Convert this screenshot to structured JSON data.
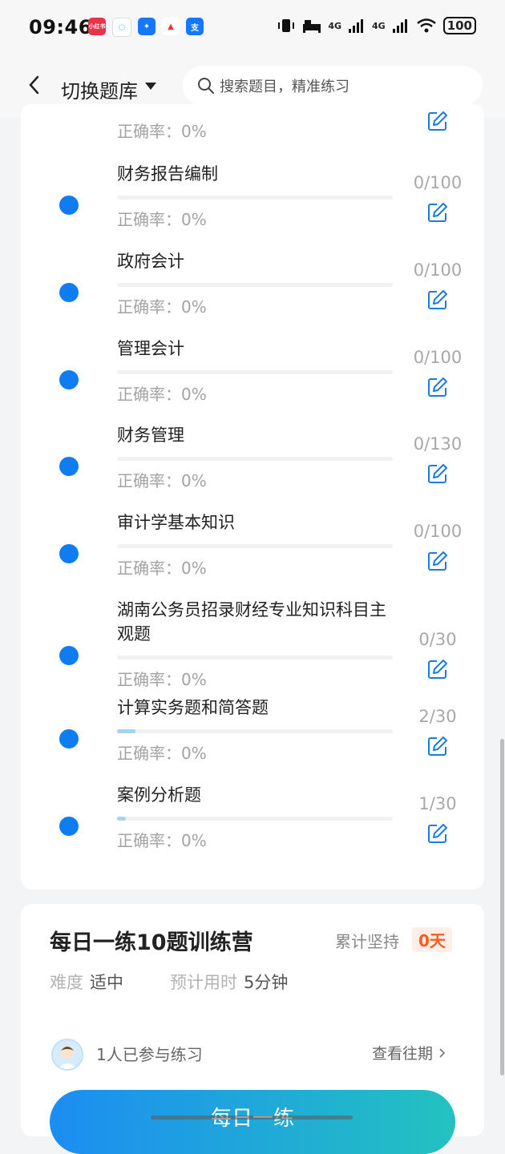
{
  "status": {
    "time": "09:46",
    "battery": "100",
    "net1": "4G",
    "net2": "4G",
    "apps": [
      "小红书",
      "◌",
      "✦",
      "▲",
      "支"
    ]
  },
  "header": {
    "switch_label": "切换题库",
    "search_placeholder": "搜索题目，精准练习"
  },
  "first_row_accuracy": "正确率：0%",
  "subjects": [
    {
      "title": "财务报告编制",
      "accuracy": "正确率：0%",
      "count": "0/100",
      "progress": 0
    },
    {
      "title": "政府会计",
      "accuracy": "正确率：0%",
      "count": "0/100",
      "progress": 0
    },
    {
      "title": "管理会计",
      "accuracy": "正确率：0%",
      "count": "0/100",
      "progress": 0
    },
    {
      "title": "财务管理",
      "accuracy": "正确率：0%",
      "count": "0/130",
      "progress": 0
    },
    {
      "title": "审计学基本知识",
      "accuracy": "正确率：0%",
      "count": "0/100",
      "progress": 0
    },
    {
      "title": "湖南公务员招录财经专业知识科目主观题",
      "accuracy": "正确率：0%",
      "count": "0/30",
      "progress": 0
    },
    {
      "title": "计算实务题和简答题",
      "accuracy": "正确率：0%",
      "count": "2/30",
      "progress": 0.067
    },
    {
      "title": "案例分析题",
      "accuracy": "正确率：0%",
      "count": "1/30",
      "progress": 0.033
    }
  ],
  "camp": {
    "title": "每日一练10题训练营",
    "streak_label": "累计坚持",
    "streak_value": "0天",
    "difficulty_label": "难度",
    "difficulty_value": "适中",
    "time_label": "预计用时",
    "time_value": "5分钟",
    "participants": "1人已参与练习",
    "history_link": "查看往期",
    "button": "每日一练"
  },
  "colors": {
    "accent": "#0f7cf2",
    "streak": "#ff5a1f",
    "button_start": "#1c8df2",
    "button_end": "#23c2c0"
  }
}
